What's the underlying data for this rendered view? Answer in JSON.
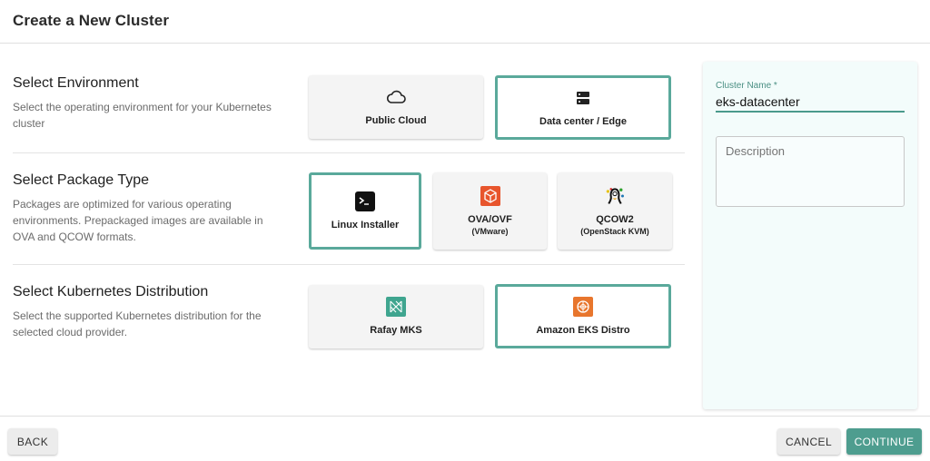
{
  "header": {
    "title": "Create a New Cluster"
  },
  "sections": {
    "environment": {
      "title": "Select Environment",
      "description": "Select the operating environment for your Kubernetes cluster",
      "options": [
        {
          "label": "Public Cloud",
          "icon": "cloud-icon",
          "selected": false
        },
        {
          "label": "Data center / Edge",
          "icon": "server-icon",
          "selected": true
        }
      ]
    },
    "package": {
      "title": "Select Package Type",
      "description": "Packages are optimized for various operating environments. Prepackaged images are available in OVA and QCOW formats.",
      "options": [
        {
          "label": "Linux Installer",
          "sublabel": "",
          "icon": "terminal-icon",
          "selected": true
        },
        {
          "label": "OVA/OVF",
          "sublabel": "(VMware)",
          "icon": "vmware-box-icon",
          "selected": false
        },
        {
          "label": "QCOW2",
          "sublabel": "(OpenStack KVM)",
          "icon": "qemu-icon",
          "selected": false
        }
      ]
    },
    "distribution": {
      "title": "Select Kubernetes Distribution",
      "description": "Select the supported Kubernetes distribution for the selected cloud provider.",
      "options": [
        {
          "label": "Rafay MKS",
          "icon": "rafay-mks-icon",
          "selected": false
        },
        {
          "label": "Amazon EKS Distro",
          "icon": "eks-distro-icon",
          "selected": true
        }
      ]
    }
  },
  "form": {
    "cluster_name_label": "Cluster Name *",
    "cluster_name_value": "eks-datacenter",
    "description_placeholder": "Description"
  },
  "footer": {
    "back_label": "BACK",
    "cancel_label": "CANCEL",
    "continue_label": "CONTINUE"
  },
  "colors": {
    "accent": "#5aa99b",
    "primary_button": "#4e9d8f",
    "panel_bg": "#f3fcfb",
    "vmware_orange": "#e8552d",
    "eks_orange": "#e8762d",
    "rafay_teal": "#3fa58f"
  }
}
